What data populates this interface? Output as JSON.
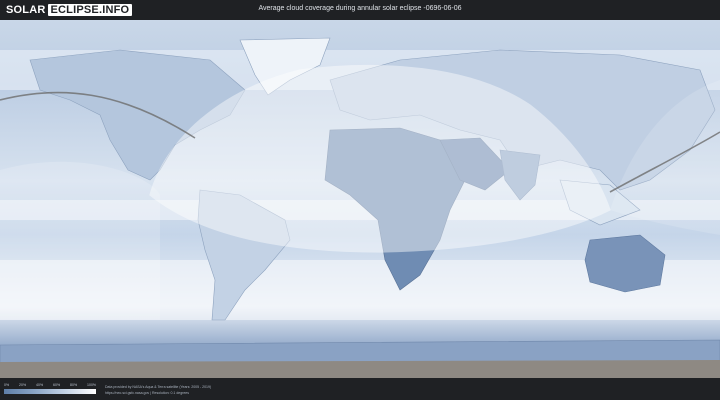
{
  "brand": {
    "part1": "SOLAR",
    "part2": "ECLIPSE.INFO"
  },
  "title": "Average cloud coverage during annular solar eclipse -0696-06-06",
  "legend": {
    "ticks": [
      "0%",
      "20%",
      "40%",
      "60%",
      "80%",
      "100%"
    ],
    "colors": [
      "#5f7fa8",
      "#8aa5c6",
      "#c4d3e6",
      "#ffffff"
    ]
  },
  "credits": {
    "line1": "Data provided by NASA's Aqua & Terra satellite (Years: 2005 - 2019)",
    "line2": "https://neo.sci.gsfc.nasa.gov  |  Resolution: 0.1 degrees"
  },
  "colors": {
    "background": "#1f2124",
    "ocean": "#cfdceb",
    "land_clear": "#6f8cb3",
    "cloud": "#f4f7fb",
    "path": "#6d6d6d"
  }
}
